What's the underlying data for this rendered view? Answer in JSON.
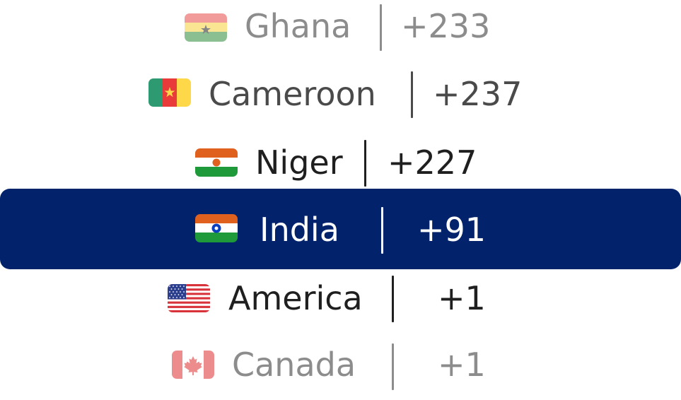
{
  "countries": [
    {
      "name": "Ghana",
      "code": "+233",
      "flag_icon": "ghana-flag-icon"
    },
    {
      "name": "Cameroon",
      "code": "+237",
      "flag_icon": "cameroon-flag-icon"
    },
    {
      "name": "Niger",
      "code": "+227",
      "flag_icon": "niger-flag-icon"
    },
    {
      "name": "India",
      "code": "+91",
      "flag_icon": "india-flag-icon",
      "selected": true
    },
    {
      "name": "America",
      "code": "+1",
      "flag_icon": "usa-flag-icon"
    },
    {
      "name": "Canada",
      "code": "+1",
      "flag_icon": "canada-flag-icon"
    }
  ],
  "colors": {
    "selected_background": "#02236b",
    "selected_text": "#ffffff",
    "text_near": "#1f1f1f",
    "text_mid": "#4a4a4a",
    "text_far": "#8c8c8c"
  }
}
